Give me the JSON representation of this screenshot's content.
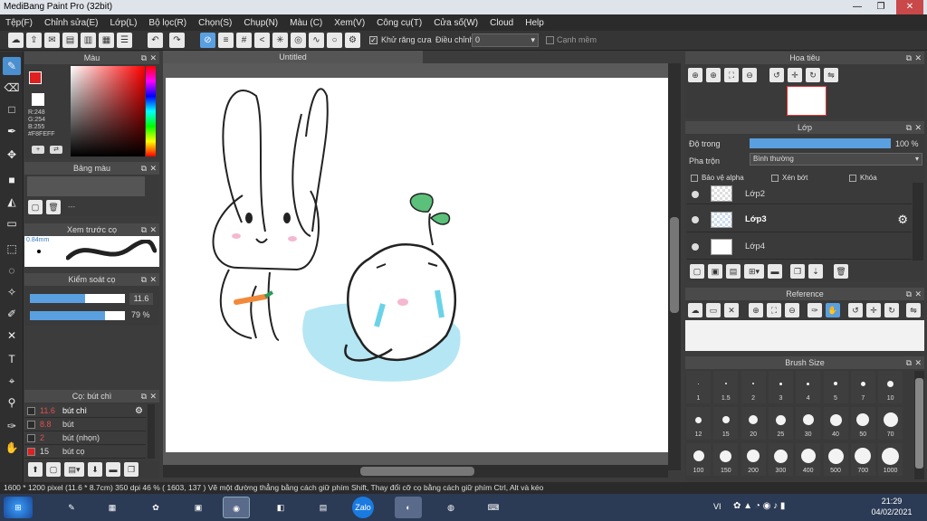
{
  "window": {
    "title": "MediBang Paint Pro (32bit)",
    "minimize": "—",
    "maximize": "❐",
    "close": "✕"
  },
  "menu": [
    "Tệp(F)",
    "Chỉnh sửa(E)",
    "Lớp(L)",
    "Bộ lọc(R)",
    "Chọn(S)",
    "Chụp(N)",
    "Màu (C)",
    "Xem(V)",
    "Công cụ(T)",
    "Cửa số(W)",
    "Cloud",
    "Help"
  ],
  "toolbar": {
    "antialias_label": "Khử răng cưa",
    "adjust_label": "Điều chỉnh",
    "adjust_value": "0",
    "margin_label": "Cạnh mềm"
  },
  "document": {
    "tab_title": "Untitled"
  },
  "color_panel": {
    "title": "Màu",
    "r": "R:248",
    "g": "G:254",
    "b": "B:255",
    "hex": "#F8FEFF"
  },
  "palette_panel": {
    "title": "Bảng màu",
    "dash": "---"
  },
  "brush_preview": {
    "title": "Xem trước cọ",
    "size": "0.84mm"
  },
  "brush_control": {
    "title": "Kiểm soát cọ",
    "size_value": "11.6",
    "opacity_value": "79 %",
    "size_fraction": 0.58,
    "opacity_fraction": 0.79
  },
  "brush_list": {
    "title": "Cọ: bút chì",
    "items": [
      {
        "size": "11.6",
        "name": "bút chì",
        "selected": true,
        "swatch": "#2b2b2b"
      },
      {
        "size": "8.8",
        "name": "bút",
        "selected": false,
        "swatch": "#2b2b2b"
      },
      {
        "size": "2",
        "name": "bút (nhọn)",
        "selected": false,
        "swatch": "#2b2b2b"
      },
      {
        "size": "15",
        "name": "bút cọ",
        "selected": false,
        "swatch": "#e02020"
      }
    ]
  },
  "navigator": {
    "title": "Hoa tiêu"
  },
  "layers": {
    "title": "Lớp",
    "opacity_label": "Độ trong",
    "opacity_value": "100 %",
    "opacity_fraction": 1.0,
    "blend_label": "Pha trộn",
    "blend_value": "Bình thường",
    "protect_alpha": "Bảo vệ alpha",
    "clipping": "Xén bớt",
    "lock": "Khóa",
    "items": [
      {
        "name": "Lớp2",
        "selected": false
      },
      {
        "name": "Lớp3",
        "selected": true
      },
      {
        "name": "Lớp4",
        "selected": false
      }
    ]
  },
  "reference": {
    "title": "Reference"
  },
  "brush_size": {
    "title": "Brush Size",
    "sizes": [
      "1",
      "1.5",
      "2",
      "3",
      "4",
      "5",
      "7",
      "10",
      "12",
      "15",
      "20",
      "25",
      "30",
      "40",
      "50",
      "70",
      "100",
      "150",
      "200",
      "300",
      "400",
      "500",
      "700",
      "1000"
    ]
  },
  "status": {
    "text": "1600 * 1200 pixel   (11.6 * 8.7cm)   350 dpi   46 %   ( 1603, 137 )   Vẽ một đường thẳng bằng cách giữ phím Shift, Thay đổi cỡ cọ bằng cách giữ phím Ctrl, Alt và kéo"
  },
  "taskbar": {
    "lang": "VI",
    "time": "21:29",
    "date": "04/02/2021",
    "apps": [
      "Zalo"
    ]
  },
  "colors": {
    "accent": "#4a8fd0",
    "selected_row": "#4f9fe0",
    "primary_color": "#e02020",
    "secondary_color": "#ffffff"
  }
}
